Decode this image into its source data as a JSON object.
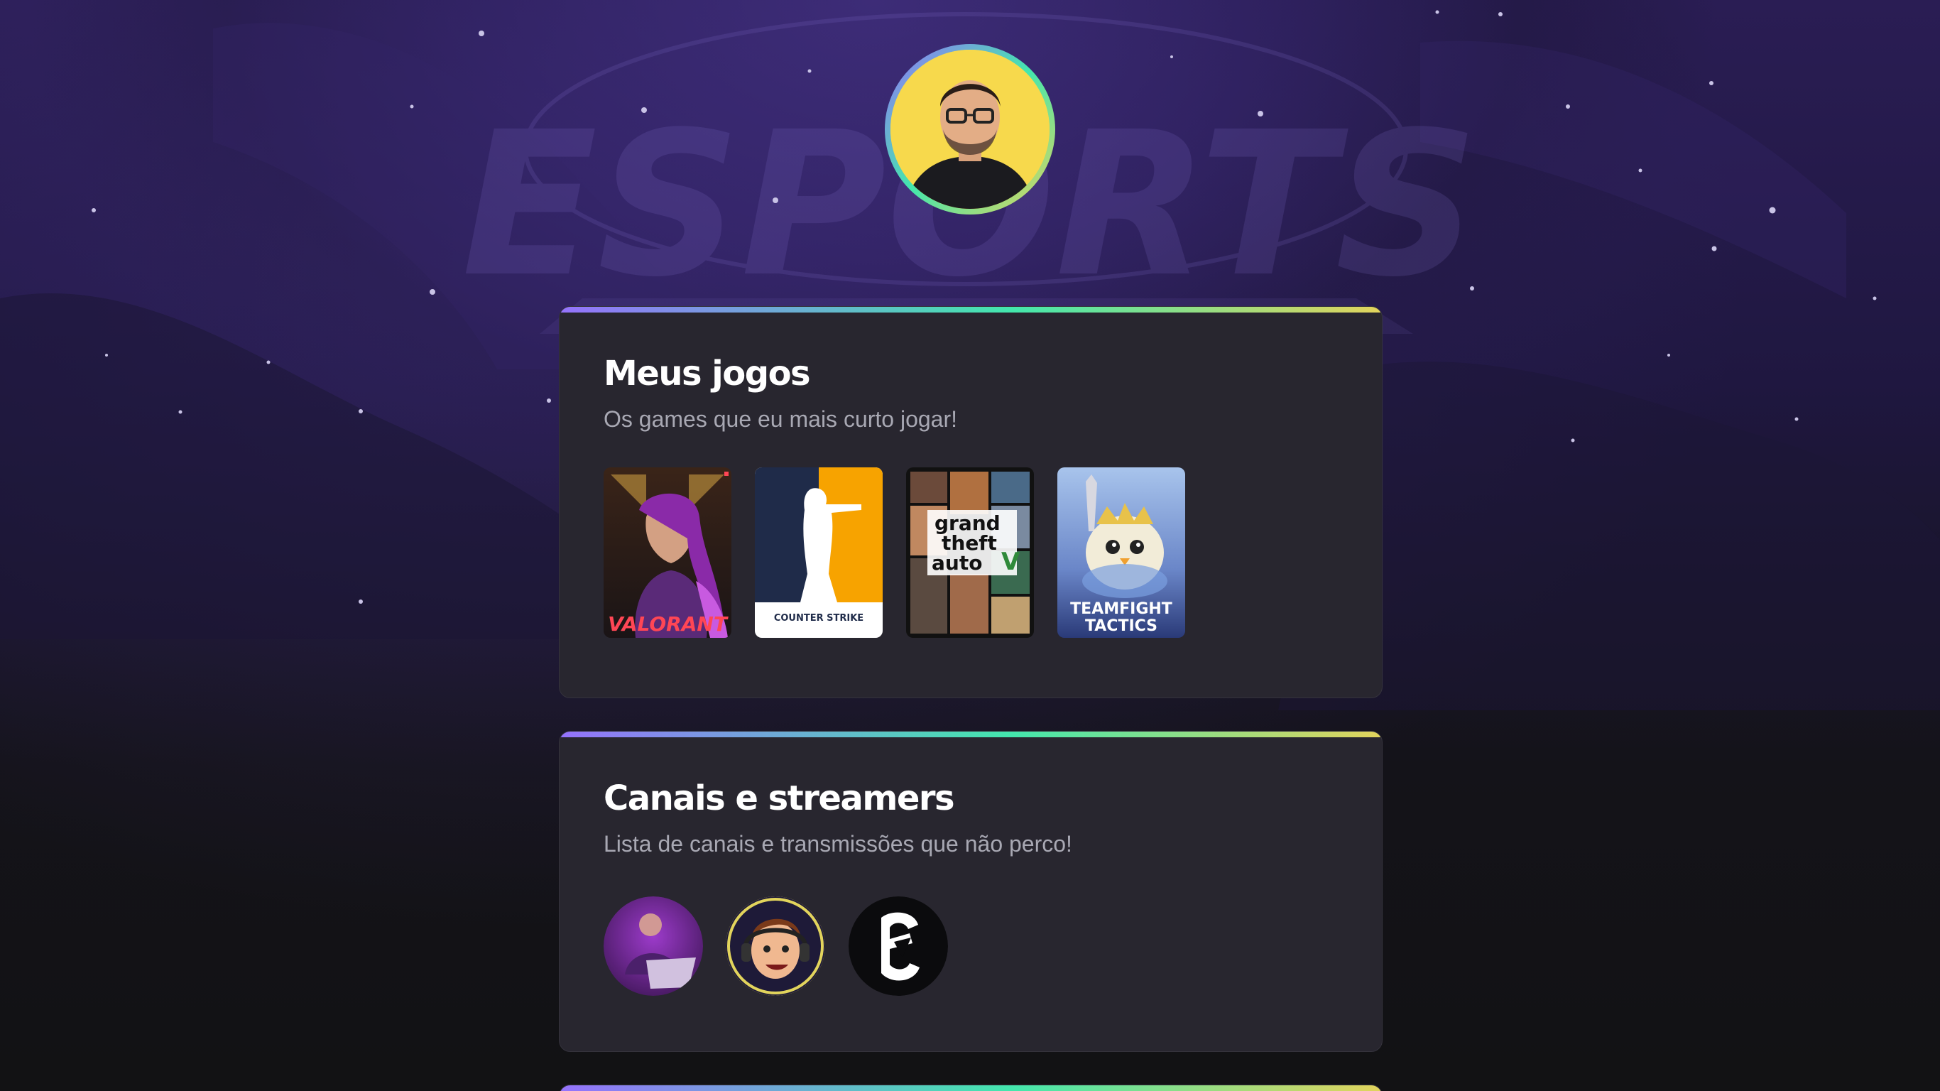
{
  "games": {
    "title": "Meus jogos",
    "subtitle": "Os games que eu mais curto jogar!",
    "items": [
      {
        "name": "VALORANT"
      },
      {
        "name": "COUNTER STRIKE",
        "name_line1": "COUNTER",
        "name_line2": "STRIKE"
      },
      {
        "name": "grand theft auto V",
        "name_line1": "grand",
        "name_line2": "theft",
        "name_line3": "auto"
      },
      {
        "name": "TEAMFIGHT TACTICS",
        "name_line1": "TEAMFIGHT",
        "name_line2": "TACTICS"
      }
    ]
  },
  "streamers": {
    "title": "Canais e streamers",
    "subtitle": "Lista de canais e transmissões que não perco!",
    "items": [
      {
        "icon": "streamer-avatar-1"
      },
      {
        "icon": "streamer-avatar-2"
      },
      {
        "icon": "streamer-avatar-3"
      }
    ]
  },
  "background": {
    "watermark": "ESPORTS"
  },
  "colors": {
    "gradient_start": "#9572FC",
    "gradient_mid": "#43E7AD",
    "gradient_end": "#E2D45C",
    "card_bg": "#28262f",
    "subtitle": "#a8a8b3"
  }
}
